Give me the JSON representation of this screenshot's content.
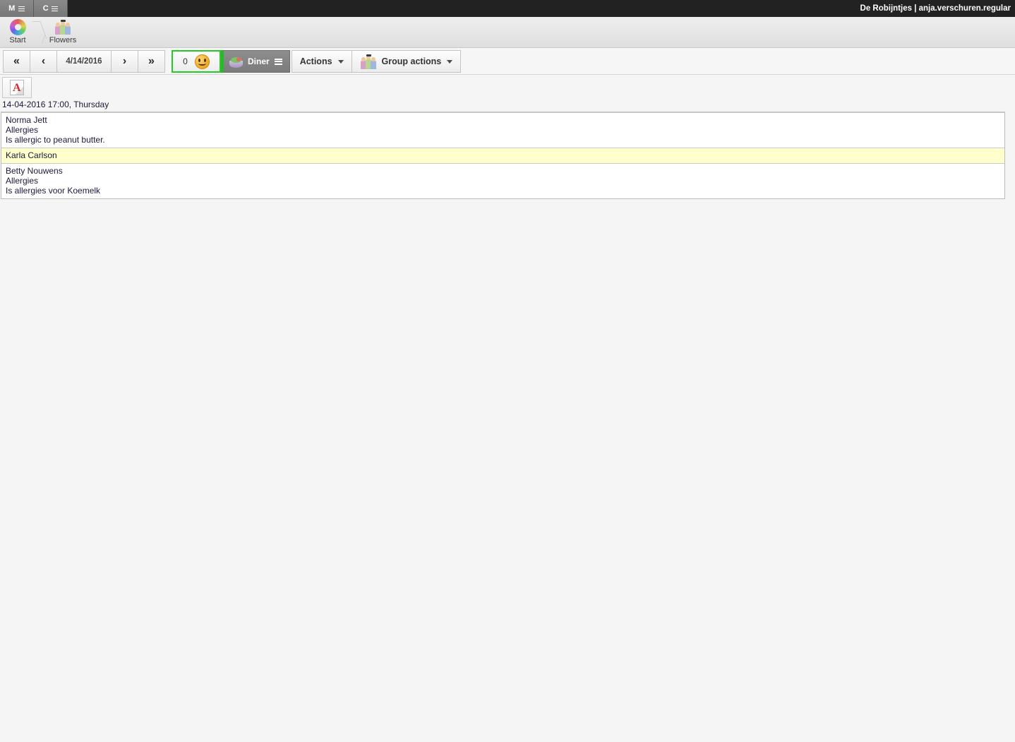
{
  "topbar": {
    "tabs": [
      {
        "label": "M",
        "icon": "hamburger-icon"
      },
      {
        "label": "C",
        "icon": "hamburger-icon"
      }
    ],
    "title": "De Robijntjes | anja.verschuren.regular"
  },
  "breadcrumb": {
    "items": [
      {
        "label": "Start",
        "icon": "color-ring-icon"
      },
      {
        "label": "Flowers",
        "icon": "people-group-icon"
      }
    ]
  },
  "toolbar": {
    "nav": {
      "first_label": "«",
      "prev_label": "‹",
      "date_value": "4/14/2016",
      "next_label": "›",
      "last_label": "»"
    },
    "counter": {
      "count": "0",
      "icon": "smiley-face-icon"
    },
    "diner": {
      "label": "Diner",
      "icon": "food-bowl-icon",
      "menu_icon": "hamburger-icon"
    },
    "actions": {
      "label": "Actions",
      "caret_icon": "caret-down-icon"
    },
    "group_actions": {
      "label": "Group actions",
      "icon": "people-group-icon",
      "caret_icon": "caret-down-icon"
    }
  },
  "export": {
    "pdf_icon": "pdf-file-icon",
    "pdf_glyph": "A"
  },
  "datestamp": "14-04-2016 17:00, Thursday",
  "list": {
    "rows": [
      {
        "name": "Norma Jett",
        "category": "Allergies",
        "detail": "Is allergic to peanut butter.",
        "selected": false
      },
      {
        "name": "Karla Carlson",
        "category": "",
        "detail": "",
        "selected": true
      },
      {
        "name": "Betty Nouwens",
        "category": "Allergies",
        "detail": "Is allergies voor Koemelk",
        "selected": false
      }
    ]
  },
  "colors": {
    "topbar_bg": "#222222",
    "accent_green": "#22cc22",
    "selected_row": "#ffffcc",
    "page_bg": "#f5f5f5"
  }
}
